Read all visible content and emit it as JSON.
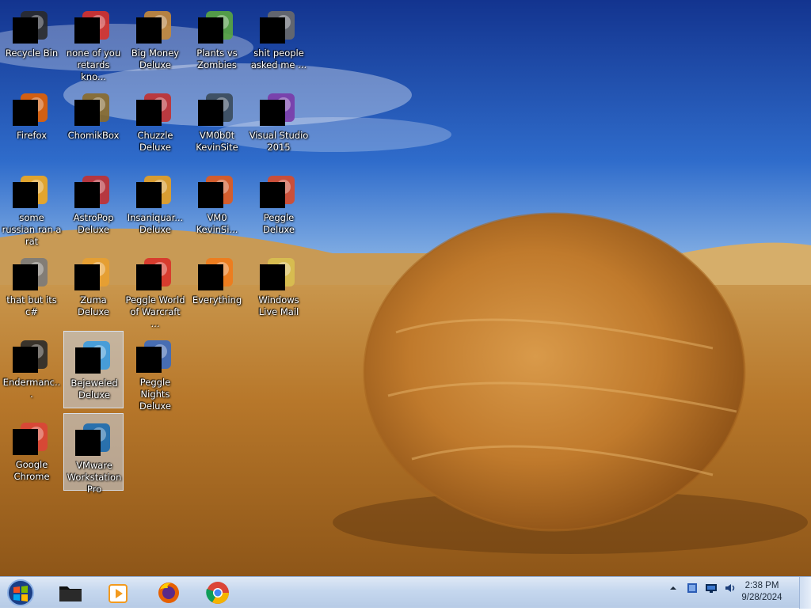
{
  "desktop": {
    "icons": [
      {
        "label": "Recycle Bin",
        "selected": false
      },
      {
        "label": "none of you retards kno...",
        "selected": false
      },
      {
        "label": "Big Money Deluxe",
        "selected": false
      },
      {
        "label": "Plants vs Zombies",
        "selected": false
      },
      {
        "label": "shit people asked me ...",
        "selected": false
      },
      {
        "label": "Firefox",
        "selected": false
      },
      {
        "label": "ChomikBox",
        "selected": false
      },
      {
        "label": "Chuzzle Deluxe",
        "selected": false
      },
      {
        "label": "VM0b0t KevinSite",
        "selected": false
      },
      {
        "label": "Visual Studio 2015",
        "selected": false
      },
      {
        "label": "some russian ran a rat",
        "selected": false
      },
      {
        "label": "AstroPop Deluxe",
        "selected": false
      },
      {
        "label": "Insaniquar... Deluxe",
        "selected": false
      },
      {
        "label": "VM0 KevinSi...",
        "selected": false
      },
      {
        "label": "Peggle Deluxe",
        "selected": false
      },
      {
        "label": "that but its c#",
        "selected": false
      },
      {
        "label": "Zuma Deluxe",
        "selected": false
      },
      {
        "label": "Peggle World of Warcraft ...",
        "selected": false
      },
      {
        "label": "Everything",
        "selected": false
      },
      {
        "label": "Windows Live Mail",
        "selected": false
      },
      {
        "label": "Endermanc...",
        "selected": false
      },
      {
        "label": "Bejeweled Deluxe",
        "selected": true
      },
      {
        "label": "Peggle Nights Deluxe",
        "selected": false
      },
      {
        "label": "Google Chrome",
        "selected": false
      },
      {
        "label": "VMware Workstation Pro",
        "selected": true
      }
    ]
  },
  "taskbar": {
    "pinned": [
      "file-explorer-icon",
      "media-player-icon",
      "firefox-icon",
      "chrome-icon"
    ],
    "tray": [
      "show-hidden-icons",
      "action-center-icon",
      "network-icon",
      "volume-icon"
    ],
    "clock": {
      "time": "2:38 PM",
      "date": "9/28/2024"
    }
  },
  "colors": {
    "taskbar": "#c5d7ee",
    "selection": "#c8d7eb"
  }
}
